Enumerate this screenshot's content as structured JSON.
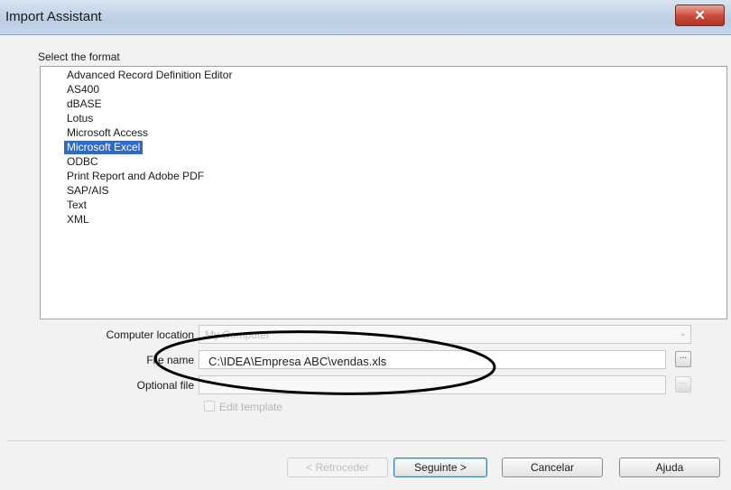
{
  "window": {
    "title": "Import Assistant",
    "close_label": "✕"
  },
  "format_section": {
    "label": "Select the format",
    "items": [
      "Advanced Record Definition Editor",
      "AS400",
      "dBASE",
      "Lotus",
      "Microsoft Access",
      "Microsoft Excel",
      "ODBC",
      "Print Report and Adobe PDF",
      "SAP/AIS",
      "Text",
      "XML"
    ],
    "selected": "Microsoft Excel"
  },
  "fields": {
    "computer_location_label": "Computer location",
    "computer_location_value": "My Computer",
    "file_name_label": "File name",
    "file_name_value": "C:\\IDEA\\Empresa ABC\\vendas.xls",
    "optional_file_label": "Optional file",
    "optional_file_value": "",
    "browse_label": "...",
    "edit_template_label": "Edit template"
  },
  "buttons": {
    "back": "< Retroceder",
    "next": "Seguinte >",
    "cancel": "Cancelar",
    "help": "Ajuda"
  },
  "colors": {
    "selection": "#3169c6",
    "annotation_ellipse": "#000000"
  },
  "icons": {
    "close": "close-icon",
    "dropdown": "chevron-down-icon"
  }
}
